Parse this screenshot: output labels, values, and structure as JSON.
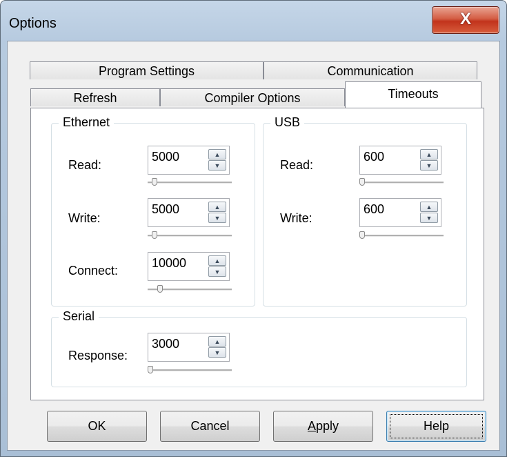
{
  "window": {
    "title": "Options",
    "close_glyph": "X"
  },
  "tabs_top": [
    "Program Settings",
    "Communication"
  ],
  "tabs_bottom": [
    "Refresh",
    "Compiler Options",
    "Timeouts"
  ],
  "active_tab": "Timeouts",
  "ethernet": {
    "title": "Ethernet",
    "read": {
      "label": "Read:",
      "value": "5000",
      "slider_fraction": 0.05
    },
    "write": {
      "label": "Write:",
      "value": "5000",
      "slider_fraction": 0.05
    },
    "connect": {
      "label": "Connect:",
      "value": "10000",
      "slider_fraction": 0.12
    }
  },
  "usb": {
    "title": "USB",
    "read": {
      "label": "Read:",
      "value": "600",
      "slider_fraction": 0.0
    },
    "write": {
      "label": "Write:",
      "value": "600",
      "slider_fraction": 0.0
    }
  },
  "serial": {
    "title": "Serial",
    "response": {
      "label": "Response:",
      "value": "3000",
      "slider_fraction": 0.0
    }
  },
  "buttons": {
    "ok": "OK",
    "cancel": "Cancel",
    "apply": "Apply",
    "apply_mnemonic": "A",
    "apply_rest": "pply",
    "help": "Help"
  },
  "icons": {
    "spin_up": "up-arrow-icon",
    "spin_down": "down-arrow-icon",
    "close": "close-icon"
  }
}
